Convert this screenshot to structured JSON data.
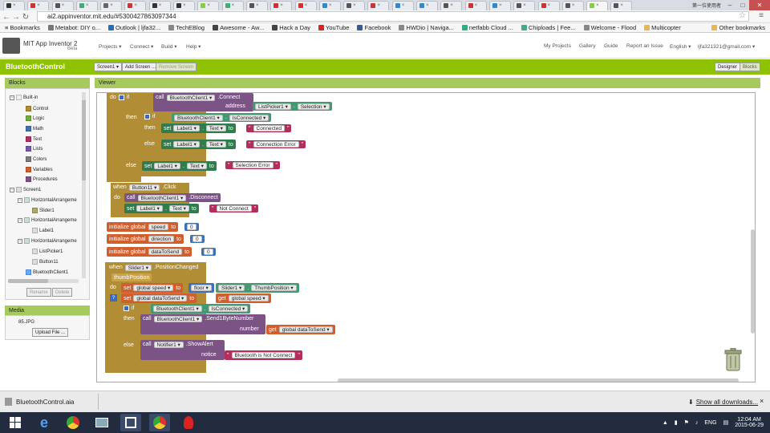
{
  "browser": {
    "url": "ai2.appinventor.mit.edu/#5300427863097344",
    "user_tag": "第一位使用者",
    "bookmarks_label": "Bookmarks",
    "bookmarks": [
      "Metabot: DIY o...",
      "Outlook | ljfa32...",
      "TechEBlog",
      "Awesome - Aw...",
      "Hack a Day",
      "YouTube",
      "Facebook",
      "HWDio | Naviga...",
      "netfabb Cloud ...",
      "Chiploads | Fee...",
      "Welcome - Flood",
      "Multicopter"
    ],
    "other_bookmarks": "Other bookmarks"
  },
  "app": {
    "title": "MIT App Inventor 2",
    "beta": "Beta",
    "menu": [
      "Projects ▾",
      "Connect ▾",
      "Build ▾",
      "Help ▾"
    ],
    "right_menu": [
      "My Projects",
      "Gallery",
      "Guide",
      "Report an Issue",
      "English ▾",
      "ljfa321321@gmail.com ▾"
    ],
    "project_name": "BluetoothControl",
    "screen_btn": "Screen1 ▾",
    "add_screen": "Add Screen ...",
    "remove_screen": "Remove Screen",
    "designer": "Designer",
    "blocks_btn": "Blocks"
  },
  "blocks_panel": {
    "header": "Blocks",
    "builtin": "Built-in",
    "items": [
      "Control",
      "Logic",
      "Math",
      "Text",
      "Lists",
      "Colors",
      "Variables",
      "Procedures"
    ],
    "screen": "Screen1",
    "arr1": "HorizontalArrangeme",
    "slider": "Slider1",
    "arr2": "HorizontalArrangeme",
    "label": "Label1",
    "arr3": "HorizontalArrangeme",
    "listpicker": "ListPicker1",
    "button": "Button11",
    "bt": "BluetoothClient1",
    "rename": "Rename",
    "delete": "Delete"
  },
  "media": {
    "header": "Media",
    "file": "85.JPG",
    "upload": "Upload File ..."
  },
  "viewer": {
    "header": "Viewer"
  },
  "workspace": {
    "do": "do",
    "if": "if",
    "then": "then",
    "else": "else",
    "call": "call",
    "set": "set",
    "to": "to",
    "when": "when",
    "bt": "BluetoothClient1 ▾",
    "connect": ".Connect",
    "address": "address",
    "listpicker": "ListPicker1 ▾",
    "selection": "Selection ▾",
    "isconnected": "IsConnected ▾",
    "label": "Label1 ▾",
    "text": "Text ▾",
    "connected": "Connected",
    "connerr": "Connection Error",
    "selerr": "Selection Error",
    "button": "Button11 ▾",
    "click": ".Click",
    "disconnect": ".Disconnect",
    "notconnected": "Not Connect",
    "init": "initialize global",
    "g_speed": "speed",
    "g_dir": "direction",
    "g_data": "dataToSend",
    "zero": "0",
    "slider": "Slider1 ▾",
    "poschanged": ".PositionChanged",
    "thumb": "thumbPosition",
    "gspeed": "global speed ▾",
    "floor": "floor ▾",
    "thumbpos": "ThumbPosition ▾",
    "gdata": "global dataToSend ▾",
    "get": "get",
    "isconn2": "IsConnected ▾",
    "send": ".Send1ByteNumber",
    "number": "number",
    "notifier": "Notifier1 ▾",
    "showalert": ".ShowAlert",
    "notice": "notice",
    "btnotconn": "Bluetooth is Not Connect"
  },
  "downloads": {
    "file": "BluetoothControl.aia",
    "showall": "Show all downloads..."
  },
  "taskbar": {
    "time": "12:04 AM",
    "date": "2015-06-29",
    "lang": "ENG"
  }
}
